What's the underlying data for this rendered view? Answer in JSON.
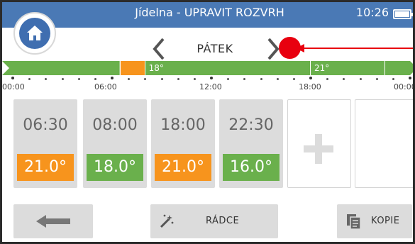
{
  "header": {
    "title": "Jídelna - UPRAVIT ROZVRH",
    "time": "10:26",
    "home_icon": "home-icon",
    "battery_icon": "battery-icon",
    "bar_color": "#4a79b5"
  },
  "day_nav": {
    "day": "PÁTEK",
    "prev_icon": "chevron-left-icon",
    "next_icon": "chevron-right-icon"
  },
  "timeline": {
    "colors": {
      "green": "#6ab04c",
      "orange": "#f7941d"
    },
    "segments": [
      {
        "from": "00:00",
        "to": "06:30",
        "color": "green",
        "label": ""
      },
      {
        "from": "06:30",
        "to": "08:00",
        "color": "orange",
        "label": ""
      },
      {
        "from": "08:00",
        "to": "18:00",
        "color": "green",
        "label": "18°"
      },
      {
        "from": "18:00",
        "to": "22:30",
        "color": "green",
        "label": "21°"
      },
      {
        "from": "22:30",
        "to": "24:00",
        "color": "green",
        "label": ""
      }
    ],
    "hour_labels": [
      "00:00",
      "06:00",
      "12:00",
      "18:00",
      "00:00"
    ]
  },
  "programs": [
    {
      "time": "06:30",
      "temp": "21.0°",
      "color": "orange"
    },
    {
      "time": "08:00",
      "temp": "18.0°",
      "color": "green"
    },
    {
      "time": "18:00",
      "temp": "21.0°",
      "color": "orange"
    },
    {
      "time": "22:30",
      "temp": "16.0°",
      "color": "green"
    }
  ],
  "add_icon": "plus-icon",
  "buttons": {
    "back_icon": "arrow-left-icon",
    "wizard_icon": "magic-wand-icon",
    "wizard_label": "RÁDCE",
    "copy_icon": "copy-icon",
    "copy_label": "KOPIE"
  },
  "annotation": {
    "color": "#e8000f",
    "icon": "red-marker-arrow"
  }
}
